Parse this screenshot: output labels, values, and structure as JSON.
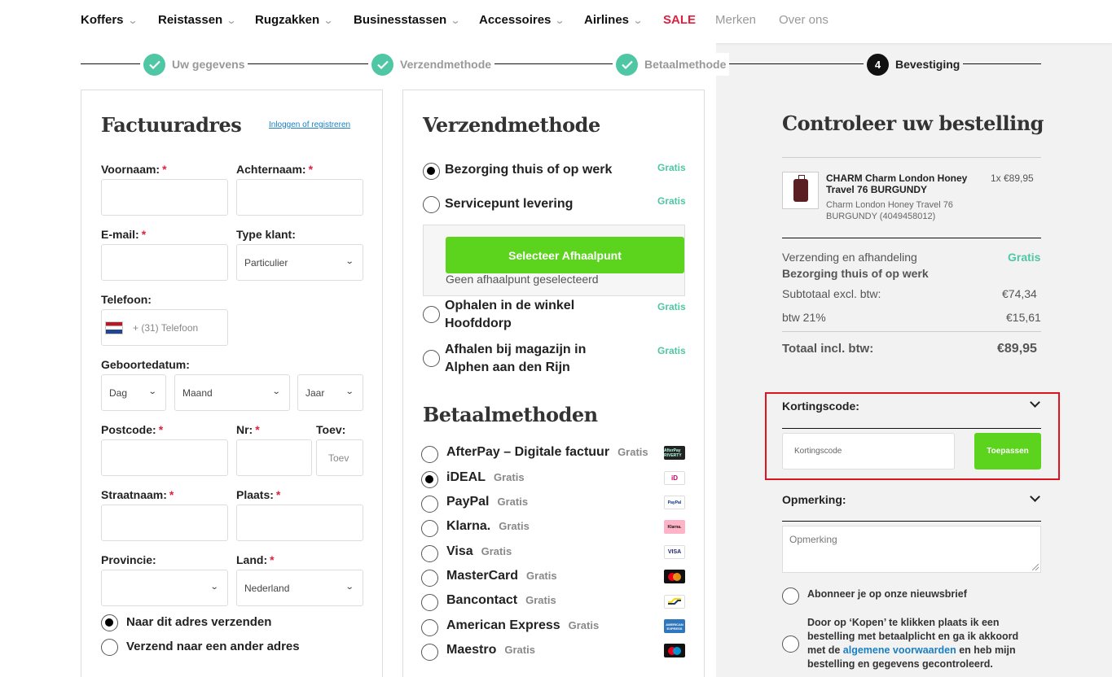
{
  "nav": {
    "items": [
      "Koffers",
      "Reistassen",
      "Rugzakken",
      "Businesstassen",
      "Accessoires",
      "Airlines"
    ],
    "sale": "SALE",
    "merken": "Merken",
    "over": "Over ons"
  },
  "steps": {
    "s1": "Uw gegevens",
    "s2": "Verzendmethode",
    "s3": "Betaalmethode",
    "s4_num": "4",
    "s4": "Bevestiging"
  },
  "billing": {
    "title": "Factuuradres",
    "login_link": "Inloggen of registreren",
    "voornaam": "Voornaam:",
    "achternaam": "Achternaam:",
    "email": "E-mail:",
    "type_klant": "Type klant:",
    "type_klant_value": "Particulier",
    "telefoon": "Telefoon:",
    "telefoon_placeholder": "+ (31) Telefoon",
    "geboortedatum": "Geboortedatum:",
    "dag": "Dag",
    "maand": "Maand",
    "jaar": "Jaar",
    "postcode": "Postcode:",
    "nr": "Nr:",
    "toev": "Toev:",
    "toev_placeholder": "Toev",
    "straatnaam": "Straatnaam:",
    "plaats": "Plaats:",
    "provincie": "Provincie:",
    "land": "Land:",
    "land_value": "Nederland",
    "ship_same": "Naar dit adres verzenden",
    "ship_other": "Verzend naar een ander adres",
    "req": "*"
  },
  "shipping": {
    "title": "Verzendmethode",
    "options": [
      {
        "label": "Bezorging thuis of op werk",
        "price": "Gratis"
      },
      {
        "label": "Servicepunt levering",
        "price": "Gratis"
      },
      {
        "label": "Ophalen in de winkel Hoofddorp",
        "price": "Gratis"
      },
      {
        "label": "Afhalen bij magazijn in Alphen aan den Rijn",
        "price": "Gratis"
      }
    ],
    "pickup_button": "Selecteer Afhaalpunt",
    "pickup_none": "Geen afhaalpunt geselecteerd"
  },
  "payment": {
    "title": "Betaalmethoden",
    "methods": [
      {
        "label": "AfterPay – Digitale factuur",
        "price": "Gratis",
        "icon": "afterpay-icon"
      },
      {
        "label": "iDEAL",
        "price": "Gratis",
        "icon": "ideal-icon"
      },
      {
        "label": "PayPal",
        "price": "Gratis",
        "icon": "paypal-icon"
      },
      {
        "label": "Klarna.",
        "price": "Gratis",
        "icon": "klarna-icon"
      },
      {
        "label": "Visa",
        "price": "Gratis",
        "icon": "visa-icon"
      },
      {
        "label": "MasterCard",
        "price": "Gratis",
        "icon": "mastercard-icon"
      },
      {
        "label": "Bancontact",
        "price": "Gratis",
        "icon": "bancontact-icon"
      },
      {
        "label": "American Express",
        "price": "Gratis",
        "icon": "amex-icon"
      },
      {
        "label": "Maestro",
        "price": "Gratis",
        "icon": "maestro-icon"
      }
    ],
    "logos": {
      "afterpay": "AfterPay RIVERTY",
      "ideal": "iD",
      "paypal": "PayPal",
      "klarna": "Klarna.",
      "visa": "VISA",
      "amex": "AMERICAN EXPRESS"
    }
  },
  "summary": {
    "title": "Controleer uw bestelling",
    "product_name": "CHARM Charm London Honey Travel 76 BURGUNDY",
    "product_qty_price": "1x €89,95",
    "product_desc": "Charm London Honey Travel 76 BURGUNDY (4049458012)",
    "shipping_label": "Verzending en afhandeling",
    "shipping_price": "Gratis",
    "shipping_method": "Bezorging thuis of op werk",
    "subtotal_label": "Subtotaal excl. btw:",
    "subtotal": "€74,34",
    "btw_label": "btw 21%",
    "btw": "€15,61",
    "total_label": "Totaal incl. btw:",
    "total": "€89,95",
    "coupon_label": "Kortingscode:",
    "coupon_placeholder": "Kortingscode",
    "coupon_button": "Toepassen",
    "remark_label": "Opmerking:",
    "remark_placeholder": "Opmerking",
    "newsletter": "Abonneer je op onze nieuwsbrief",
    "terms_before": "Door op ‘Kopen’ te klikken plaats ik een bestelling met betaalplicht en ga ik akkoord met de ",
    "terms_link": "algemene voorwaarden",
    "terms_after": " en heb mijn bestelling en gegevens gecontroleerd."
  },
  "colors": {
    "accent_green": "#5cd31c",
    "teal": "#4fc7a4",
    "sale_red": "#e0203f",
    "highlight_red": "#e0141e",
    "link_blue": "#1a7fc1"
  }
}
